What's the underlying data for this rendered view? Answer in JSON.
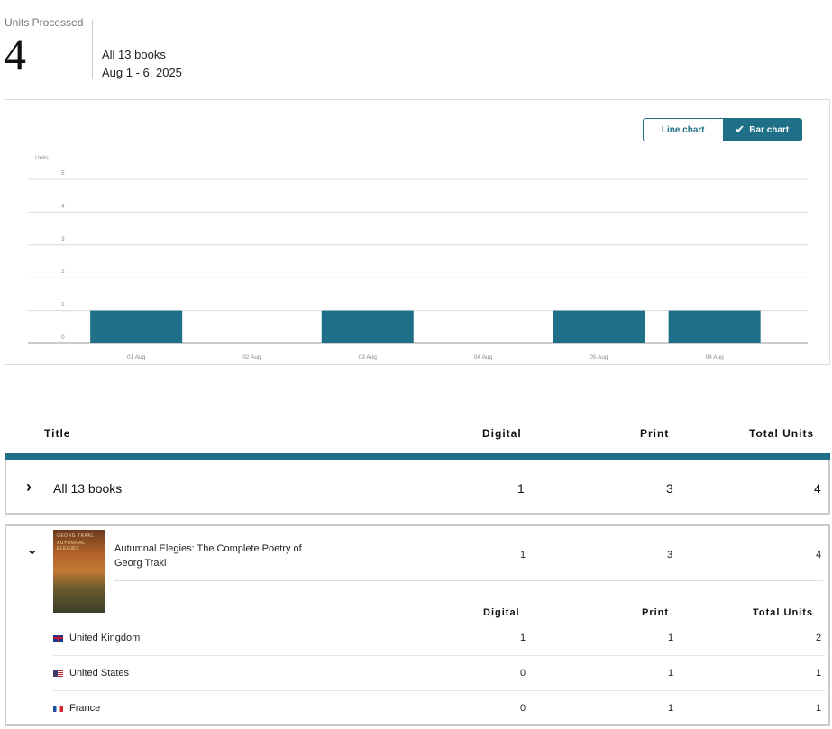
{
  "summary": {
    "label": "Units Processed",
    "value": "4",
    "scope": "All 13 books",
    "dates": "Aug 1 - 6, 2025"
  },
  "chart_toggle": {
    "line_label": "Line chart",
    "bar_label": "Bar chart",
    "selected": "bar"
  },
  "chart_data": {
    "type": "bar",
    "ylabel": "Units",
    "categories": [
      "01 Aug",
      "02 Aug",
      "03 Aug",
      "04 Aug",
      "05 Aug",
      "06 Aug"
    ],
    "values": [
      1,
      0,
      1,
      0,
      1,
      1
    ],
    "ylim": [
      0,
      5
    ],
    "yticks": [
      0,
      1,
      2,
      3,
      4,
      5
    ],
    "grid": true,
    "bar_color": "#1e6f87"
  },
  "table": {
    "headers": {
      "title": "Title",
      "digital": "Digital",
      "print": "Print",
      "total": "Total Units"
    },
    "all_row": {
      "title": "All 13 books",
      "digital": "1",
      "print": "3",
      "total": "4"
    },
    "book": {
      "title": "Autumnal Elegies: The Complete Poetry of Georg Trakl",
      "digital": "1",
      "print": "3",
      "total": "4",
      "cover_line1": "GEORG TRAKL",
      "cover_line2": "AUTUMNAL ELEGIES",
      "sub_headers": {
        "digital": "Digital",
        "print": "Print",
        "total": "Total Units"
      },
      "countries": [
        {
          "name": "United Kingdom",
          "flag": "uk-flag",
          "digital": "1",
          "print": "1",
          "total": "2"
        },
        {
          "name": "United States",
          "flag": "us-flag",
          "digital": "0",
          "print": "1",
          "total": "1"
        },
        {
          "name": "France",
          "flag": "fr-flag",
          "digital": "0",
          "print": "1",
          "total": "1"
        }
      ]
    }
  },
  "accent_color": "#1e6f87"
}
